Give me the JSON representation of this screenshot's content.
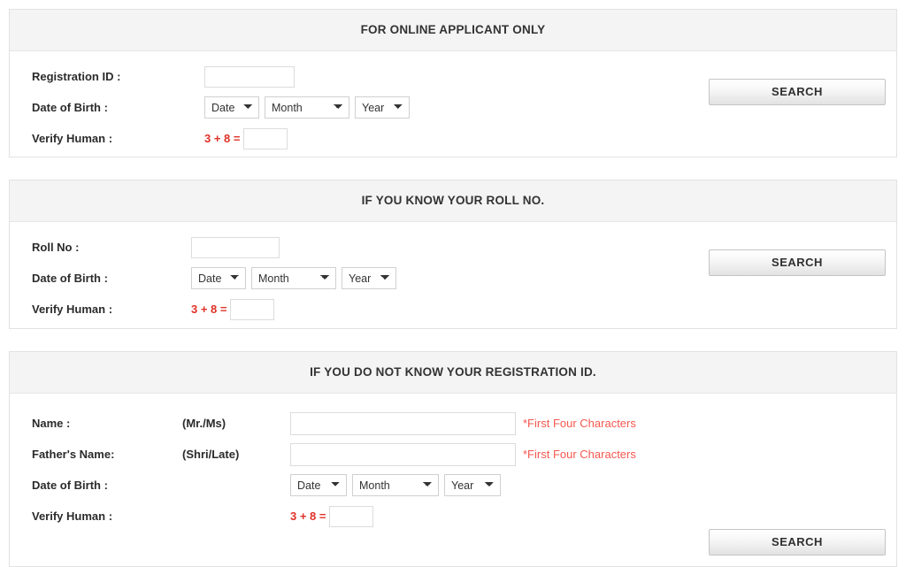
{
  "panels": [
    {
      "id": "online",
      "title": "FOR ONLINE APPLICANT ONLY",
      "fields": {
        "registration_id_label": "Registration ID :",
        "registration_id_value": "",
        "dob_label": "Date of Birth :",
        "dob_date": "Date",
        "dob_month": "Month",
        "dob_year": "Year",
        "verify_label": "Verify Human :",
        "captcha_equation": "3 + 8 =",
        "captcha_value": ""
      },
      "search_label": "SEARCH"
    },
    {
      "id": "roll",
      "title": "IF YOU KNOW YOUR ROLL NO.",
      "fields": {
        "roll_no_label": "Roll No :",
        "roll_no_value": "",
        "dob_label": "Date of Birth :",
        "dob_date": "Date",
        "dob_month": "Month",
        "dob_year": "Year",
        "verify_label": "Verify Human :",
        "captcha_equation": "3 + 8 =",
        "captcha_value": ""
      },
      "search_label": "SEARCH"
    },
    {
      "id": "noreg",
      "title": "IF YOU DO NOT KNOW YOUR REGISTRATION ID.",
      "fields": {
        "name_label": "Name :",
        "name_prefix": "(Mr./Ms)",
        "name_value": "",
        "name_hint": "*First Four Characters",
        "father_name_label": "Father's Name:",
        "father_name_prefix": "(Shri/Late)",
        "father_name_value": "",
        "father_name_hint": "*First Four Characters",
        "dob_label": "Date of Birth :",
        "dob_date": "Date",
        "dob_month": "Month",
        "dob_year": "Year",
        "verify_label": "Verify Human :",
        "captcha_equation": "3 + 8 =",
        "captcha_value": ""
      },
      "search_label": "SEARCH"
    }
  ],
  "colors": {
    "captcha_red": "#e03127",
    "hint_red": "#f4584f",
    "header_bg": "#f4f4f4",
    "panel_border": "#e2e2e2"
  },
  "select_options": {
    "date": "Date",
    "month": "Month",
    "year": "Year"
  }
}
